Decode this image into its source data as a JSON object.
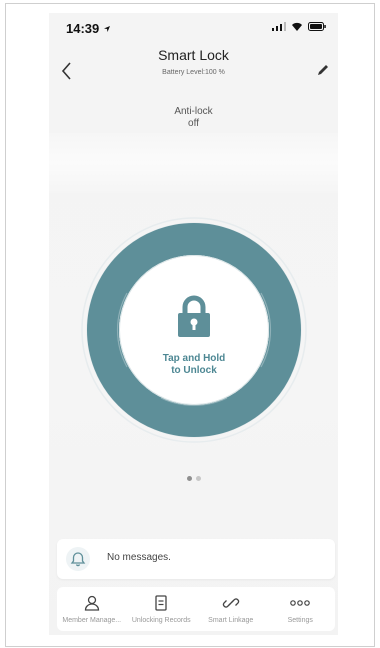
{
  "status_bar": {
    "time": "14:39"
  },
  "header": {
    "title": "Smart Lock",
    "subtitle": "Battery Level:100 %"
  },
  "anti_lock": {
    "label": "Anti-lock",
    "value": "off"
  },
  "lock": {
    "line1": "Tap and Hold",
    "line2": "to Unlock"
  },
  "pager": {
    "count": 2,
    "active_index": 0
  },
  "messages": {
    "text": "No messages."
  },
  "tabs": [
    {
      "label": "Member Manage...",
      "icon": "person-icon"
    },
    {
      "label": "Unlocking Records",
      "icon": "records-icon"
    },
    {
      "label": "Smart Linkage",
      "icon": "link-icon"
    },
    {
      "label": "Settings",
      "icon": "more-icon"
    }
  ],
  "colors": {
    "accent": "#5e8f99",
    "label": "#4d8793"
  }
}
